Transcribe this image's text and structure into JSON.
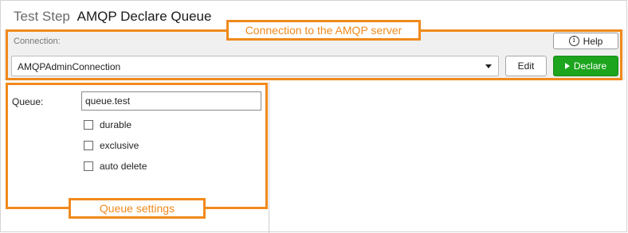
{
  "header": {
    "prefix": "Test Step",
    "title": "AMQP Declare Queue"
  },
  "connection": {
    "label": "Connection:",
    "selected": "AMQPAdminConnection",
    "help_label": "Help",
    "edit_label": "Edit",
    "declare_label": "Declare"
  },
  "queue": {
    "label": "Queue:",
    "value": "queue.test",
    "options": [
      {
        "label": "durable",
        "checked": false
      },
      {
        "label": "exclusive",
        "checked": false
      },
      {
        "label": "auto delete",
        "checked": false
      }
    ]
  },
  "annotations": {
    "connection": "Connection to the AMQP server",
    "queue": "Queue settings"
  },
  "colors": {
    "highlight": "#f08a1c",
    "declare": "#1da51d"
  },
  "icons": {
    "help": "info-circle-icon",
    "declare": "play-icon",
    "dropdown": "chevron-down-icon"
  }
}
